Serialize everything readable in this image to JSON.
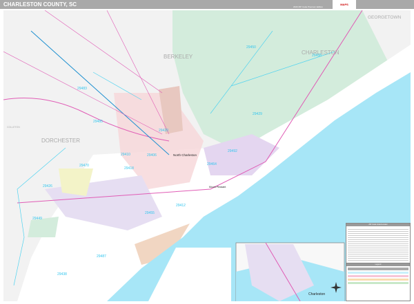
{
  "header": {
    "title": "CHARLESTON COUNTY, SC",
    "edition": "2020 ZIP Code Premium Edition",
    "logo": "MAPS"
  },
  "counties": {
    "berkeley": "BERKELEY",
    "charleston": "CHARLESTON",
    "dorchester": "DORCHESTER",
    "georgetown": "GEORGETOWN",
    "colleton": "COLLETON"
  },
  "zips": {
    "z29450": "29450",
    "z29458": "29458",
    "z29429": "29429",
    "z29483": "29483",
    "z29485": "29485",
    "z29420": "29420",
    "z29410": "29410",
    "z29464": "29464",
    "z29492": "29492",
    "z29418": "29418",
    "z29470": "29470",
    "z29426": "29426",
    "z29449": "29449",
    "z29455": "29455",
    "z29412": "29412",
    "z29487": "29487",
    "z29438": "29438",
    "z29406": "29406"
  },
  "cities": {
    "north_charleston": "North Charleston",
    "mount_pleasant": "Mount Pleasant",
    "inset_charleston": "Charleston"
  },
  "legend": {
    "index_title": "ZIP Code Index/Locator",
    "legend_title": "Legend"
  },
  "colors": {
    "water": "#a7e6f7",
    "national_forest": "#d3ecdc",
    "land": "#f2f2f2",
    "county": "#ffffff",
    "zip_line": "#4fd3f0",
    "highway": "#e05bb5"
  }
}
